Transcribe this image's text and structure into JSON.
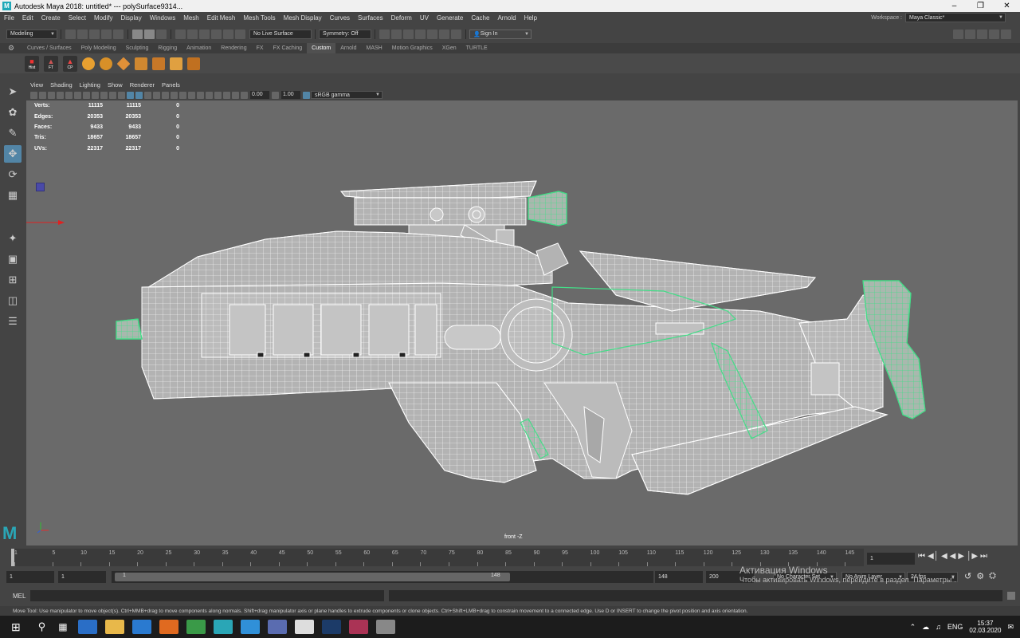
{
  "titlebar": {
    "title": "Autodesk Maya 2018: untitled*   ---   polySurface9314..."
  },
  "menu": [
    "File",
    "Edit",
    "Create",
    "Select",
    "Modify",
    "Display",
    "Windows",
    "Mesh",
    "Edit Mesh",
    "Mesh Tools",
    "Mesh Display",
    "Curves",
    "Surfaces",
    "Deform",
    "UV",
    "Generate",
    "Cache",
    "Arnold",
    "Help"
  ],
  "workspace": {
    "label": "Workspace :",
    "value": "Maya Classic*"
  },
  "statusline": {
    "mode": "Modeling",
    "live_surface": "No Live Surface",
    "symmetry": "Symmetry: Off",
    "sign_in": "Sign In"
  },
  "shelf_tabs": [
    "Curves / Surfaces",
    "Poly Modeling",
    "Sculpting",
    "Rigging",
    "Animation",
    "Rendering",
    "FX",
    "FX Caching",
    "Custom",
    "Arnold",
    "MASH",
    "Motion Graphics",
    "XGen",
    "TURTLE"
  ],
  "shelf_active": "Custom",
  "shelf_labels": [
    "Hist",
    "FT",
    "CP"
  ],
  "panel_menu": [
    "View",
    "Shading",
    "Lighting",
    "Show",
    "Renderer",
    "Panels"
  ],
  "panel_tools": {
    "exposure": "0.00",
    "gamma": "1.00",
    "color_space": "sRGB gamma"
  },
  "hud": [
    {
      "label": "Verts:",
      "a": "11115",
      "b": "11115",
      "c": "0"
    },
    {
      "label": "Edges:",
      "a": "20353",
      "b": "20353",
      "c": "0"
    },
    {
      "label": "Faces:",
      "a": "9433",
      "b": "9433",
      "c": "0"
    },
    {
      "label": "Tris:",
      "a": "18657",
      "b": "18657",
      "c": "0"
    },
    {
      "label": "UVs:",
      "a": "22317",
      "b": "22317",
      "c": "0"
    }
  ],
  "camera_label": "front -Z",
  "timeline": {
    "ticks": [
      "1",
      "5",
      "10",
      "15",
      "20",
      "25",
      "30",
      "35",
      "40",
      "45",
      "50",
      "55",
      "60",
      "65",
      "70",
      "75",
      "80",
      "85",
      "90",
      "95",
      "100",
      "105",
      "110",
      "115",
      "120",
      "125",
      "130",
      "135",
      "140",
      "145"
    ],
    "current_frame": "1"
  },
  "range": {
    "start": "1",
    "start2": "1",
    "slider_start": "1",
    "slider_end": "148",
    "end": "148",
    "end2": "200",
    "character_set": "No Character Set",
    "anim_layer": "No Anim Layer",
    "fps": "24 fps"
  },
  "mel": {
    "label": "MEL"
  },
  "help_line": "Move Tool: Use manipulator to move object(s). Ctrl+MMB+drag to move components along normals. Shift+drag manipulator axis or plane handles to extrude components or clone objects. Ctrl+Shift+LMB+drag to constrain movement to a connected edge. Use D or INSERT to change the pivot position and axis orientation.",
  "activation": {
    "line1": "Активация Windows",
    "line2": "Чтобы активировать Windows, перейдите в раздел \"Параметры\"."
  },
  "taskbar": {
    "time": "15:37",
    "date": "02.03.2020",
    "lang": "ENG"
  },
  "colors": {
    "wire": "#ffffff",
    "selected_wire": "#44dd88",
    "viewport_bg": "#6a6a6a"
  }
}
